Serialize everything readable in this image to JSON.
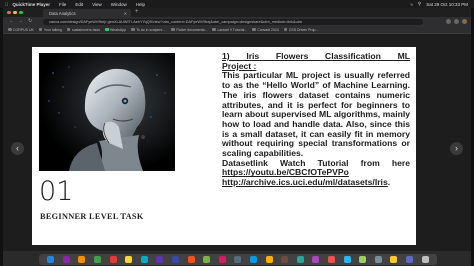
{
  "menubar": {
    "items": [
      "QuickTime Player",
      "File",
      "Edit",
      "View",
      "Window",
      "Help"
    ],
    "datetime": "Sat 29 Oct  10:33 PM"
  },
  "browser": {
    "tab_title": "Data Analytics",
    "url": "canva.com/design/DAFyeWV9kej/-genXLAUWITI-AehYYqQ9/view?utm_content=DAFyeWV9kej&utm_campaign=designshare&utm_medium=link&utm",
    "bookmarks": [
      "CORPUS UK",
      "Your talking",
      "sustainovers facts",
      "WhatsApp",
      "To do in scalpers ...",
      "Flutter documenta...",
      "Laravel 9 Tutorial...",
      "Canvadi 2024",
      "CSS Driven Prop..."
    ]
  },
  "slide": {
    "number": "01",
    "task_label": "BEGINNER LEVEL TASK",
    "title_line1": "1)  Iris  Flowers  Classification  ML",
    "title_line2": "Project :",
    "description": "This particular ML project is usually referred to as the “Hello World” of Machine Learning. The iris flowers dataset contains numeric attributes, and it is perfect for beginners to learn about supervised ML algorithms, mainly how to load and handle data. Also, since this is a small dataset, it can easily fit in memory without requiring special transformations or scaling capabilities.",
    "dataset_line": "Datasetlink Watch Tutorial from here",
    "link1": "https://youtu.be/CBCfOTePVPo",
    "link2": "http://archive.ics.uci.edu/ml/datasets/Iris",
    "link_suffix": "."
  }
}
